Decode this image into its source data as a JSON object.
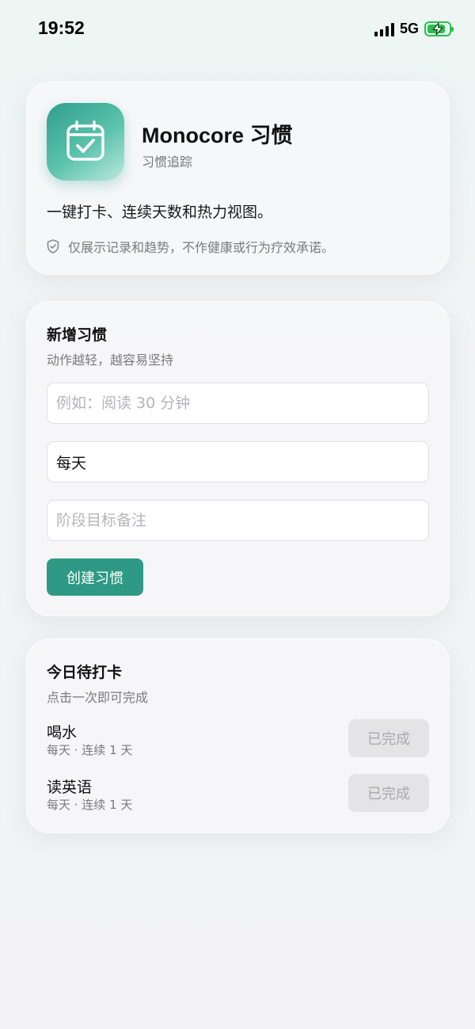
{
  "status_bar": {
    "time": "19:52",
    "network": "5G",
    "battery_charging": true,
    "battery_color": "#2bbf4f"
  },
  "app": {
    "icon": "calendar-check-icon",
    "title": "Monocore 习惯",
    "subtitle": "习惯追踪",
    "description": "一键打卡、连续天数和热力视图。",
    "disclaimer_icon": "shield-check-icon",
    "disclaimer": "仅展示记录和趋势，不作健康或行为疗效承诺。",
    "accent_color": "#2e9a86"
  },
  "new_habit": {
    "title": "新增习惯",
    "subtitle": "动作越轻，越容易坚持",
    "name_placeholder": "例如：阅读 30 分钟",
    "name_value": "",
    "frequency_value": "每天",
    "note_placeholder": "阶段目标备注",
    "note_value": "",
    "create_label": "创建习惯"
  },
  "today": {
    "title": "今日待打卡",
    "subtitle": "点击一次即可完成",
    "habits": [
      {
        "name": "喝水",
        "meta": "每天 · 连续 1 天",
        "button_label": "已完成"
      },
      {
        "name": "读英语",
        "meta": "每天 · 连续 1 天",
        "button_label": "已完成"
      }
    ]
  }
}
